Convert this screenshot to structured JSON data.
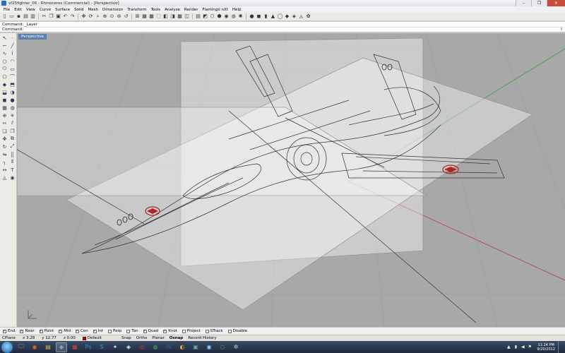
{
  "window": {
    "title": "vf25fighter_06 - Rhinoceros (Commercial) - [Perspective]",
    "minimize": "–",
    "maximize": "❐",
    "close": "✕"
  },
  "menu": [
    "File",
    "Edit",
    "View",
    "Curve",
    "Surface",
    "Solid",
    "Mesh",
    "Dimension",
    "Transform",
    "Tools",
    "Analyze",
    "Render",
    "Flamingo nXt",
    "Help"
  ],
  "command": {
    "history": "Command: _Layer",
    "prompt": "Command:",
    "scroll_glyph": "⇕"
  },
  "viewport": {
    "tab_label": "Perspective",
    "background": "#a8a8a8",
    "grid_color": "#9c9c9c",
    "axis_x_color": "#b04040",
    "axis_y_color": "#3f9f3f",
    "plane_fill": "rgba(255,255,255,0.45)",
    "wireframe_color": "#333333",
    "insignia_color": "#b22222"
  },
  "osnaps": [
    {
      "label": "End",
      "checked": true
    },
    {
      "label": "Near",
      "checked": true
    },
    {
      "label": "Point",
      "checked": true
    },
    {
      "label": "Mid",
      "checked": true
    },
    {
      "label": "Cen",
      "checked": true
    },
    {
      "label": "Int",
      "checked": true
    },
    {
      "label": "Perp",
      "checked": false
    },
    {
      "label": "Tan",
      "checked": false
    },
    {
      "label": "Quad",
      "checked": true
    },
    {
      "label": "Knot",
      "checked": true
    },
    {
      "label": "Project",
      "checked": false
    },
    {
      "label": "STrack",
      "checked": false
    },
    {
      "label": "Disable",
      "checked": false
    }
  ],
  "status": {
    "cplane": "CPlane",
    "x": "x 3.28",
    "y": "y 12.77",
    "z": "z 0.00",
    "layer": "Default",
    "layer_color": "#cc0000",
    "toggles": [
      {
        "label": "Snap",
        "bold": false
      },
      {
        "label": "Ortho",
        "bold": false
      },
      {
        "label": "Planar",
        "bold": false
      },
      {
        "label": "Osnap",
        "bold": true
      },
      {
        "label": "Record History",
        "bold": false
      }
    ]
  },
  "taskbar": {
    "time": "11:24 PM",
    "date": "9/20/2012",
    "apps": [
      {
        "name": "explorer-icon",
        "glyph": "🗀",
        "color": "#f0c040",
        "active": false
      },
      {
        "name": "firefox-icon",
        "glyph": "◉",
        "color": "#e66a1f",
        "active": false
      },
      {
        "name": "folder-icon",
        "glyph": "▤",
        "color": "#e0b050",
        "active": false
      },
      {
        "name": "rhino-icon",
        "glyph": "◆",
        "color": "#7fa0d0",
        "active": true
      },
      {
        "name": "app-icon",
        "glyph": "▦",
        "color": "#c44",
        "active": false
      },
      {
        "name": "photoshop-icon",
        "glyph": "Ps",
        "color": "#3a7fd0",
        "active": false
      },
      {
        "name": "skype-icon",
        "glyph": "S",
        "color": "#2aa0e0",
        "active": false
      },
      {
        "name": "3d-app-icon",
        "glyph": "✦",
        "color": "#ddd",
        "active": false
      },
      {
        "name": "unity-icon",
        "glyph": "◈",
        "color": "#eee",
        "active": false
      },
      {
        "name": "browser-icon",
        "glyph": "◎",
        "color": "#c33",
        "active": false
      },
      {
        "name": "chrome-icon",
        "glyph": "◍",
        "color": "#4caf50",
        "active": false
      },
      {
        "name": "word-icon",
        "glyph": "W",
        "color": "#2b5797",
        "active": false
      },
      {
        "name": "tool-icon",
        "glyph": "◐",
        "color": "#e8a020",
        "active": false
      },
      {
        "name": "image-icon",
        "glyph": "▣",
        "color": "#6a9",
        "active": false
      },
      {
        "name": "eye-icon",
        "glyph": "◉",
        "color": "#9cf",
        "active": false
      },
      {
        "name": "globe-icon",
        "glyph": "◌",
        "color": "#9c6",
        "active": false
      },
      {
        "name": "settings-icon",
        "glyph": "✲",
        "color": "#ccc",
        "active": false
      }
    ]
  }
}
